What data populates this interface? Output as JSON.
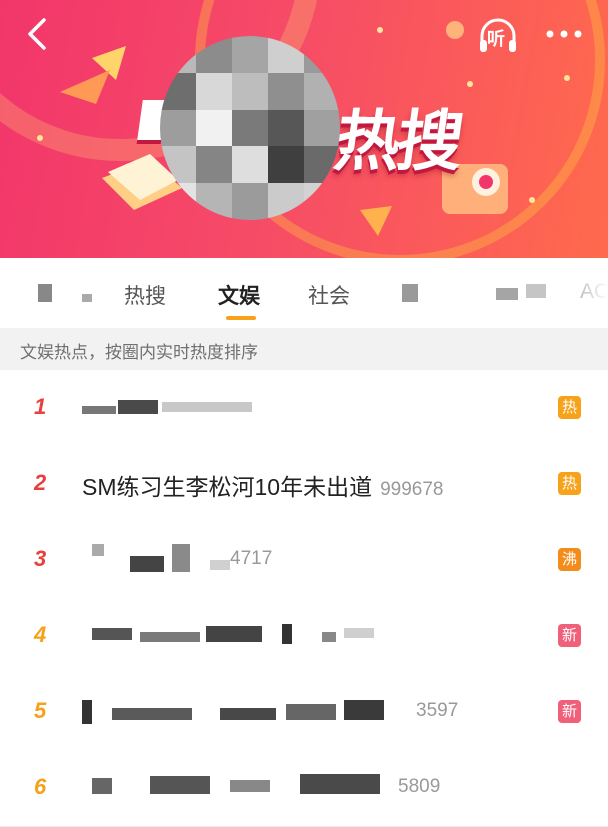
{
  "banner": {
    "title_chars": [
      "热",
      "搜"
    ],
    "listen_label": "听",
    "accent_color": "#f2366a"
  },
  "tabs": [
    {
      "label": "热搜"
    },
    {
      "label": "文娱",
      "active": true
    },
    {
      "label": "社会"
    },
    {
      "label": "AC"
    }
  ],
  "subheader": "文娱热点，按圈内实时热度排序",
  "list": [
    {
      "rank": "1",
      "badge": "热",
      "badge_color": "#f7a21b",
      "rank_color": "#e8403e"
    },
    {
      "rank": "2",
      "title": "SM练习生李松河10年未出道",
      "count": "999678",
      "badge": "热",
      "badge_color": "#f7a21b",
      "rank_color": "#e8403e"
    },
    {
      "rank": "3",
      "count": "4717",
      "badge": "沸",
      "badge_color": "#f28d1c",
      "rank_color": "#e8403e"
    },
    {
      "rank": "4",
      "badge": "新",
      "badge_color": "#f0607a",
      "rank_color": "#f5a11b"
    },
    {
      "rank": "5",
      "count": "3597",
      "badge": "新",
      "badge_color": "#f0607a",
      "rank_color": "#f5a11b"
    },
    {
      "rank": "6",
      "count": "5809",
      "rank_color": "#f5a11b"
    }
  ]
}
